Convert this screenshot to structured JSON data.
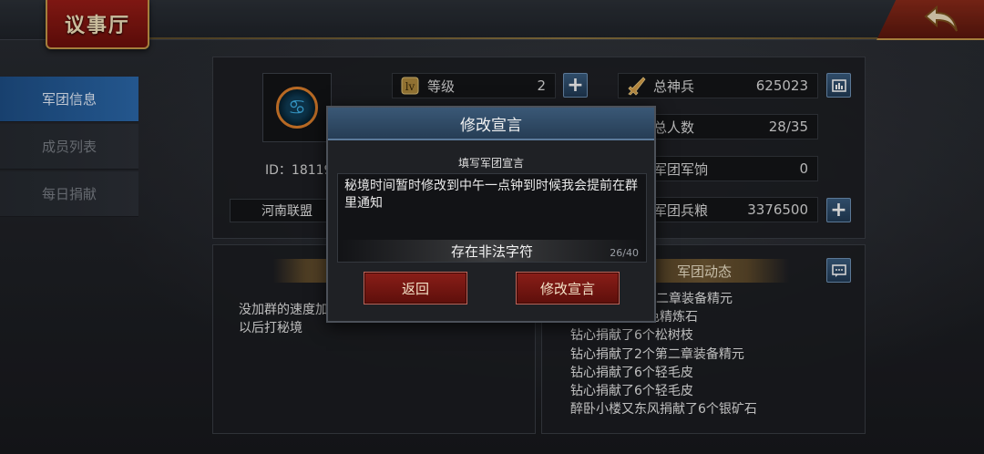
{
  "header": {
    "title": "议事厅"
  },
  "sidebar": {
    "items": [
      {
        "label": "军团信息",
        "active": true
      },
      {
        "label": "成员列表",
        "active": false
      },
      {
        "label": "每日捐献",
        "active": false
      }
    ]
  },
  "legion": {
    "id_text": "ID：18119",
    "name": "河南联盟",
    "level_label": "等级",
    "level_value": "2",
    "total_troops_label": "总神兵",
    "total_troops_value": "625023",
    "members_label": "总人数",
    "members_value": "28/35",
    "pay_label": "军团军饷",
    "pay_value": "0",
    "grain_label": "军团兵粮",
    "grain_value": "3376500"
  },
  "declaration": {
    "text": "没加群的速度加 以后打秘境"
  },
  "news": {
    "title": "军团动态",
    "items": [
      "第二章装备精元",
      "蓝色精炼石",
      "钻心捐献了6个松树枝",
      "钻心捐献了2个第二章装备精元",
      "钻心捐献了6个轻毛皮",
      "钻心捐献了6个轻毛皮",
      "醉卧小楼又东风捐献了6个银矿石"
    ]
  },
  "modal": {
    "title": "修改宣言",
    "subtitle": "填写军团宣言",
    "input_text": "秘境时间暂时修改到中午一点钟到时候我会提前在群里通知",
    "error": "存在非法字符",
    "counter": "26/40",
    "back_label": "返回",
    "submit_label": "修改宣言"
  },
  "colors": {
    "accent_blue": "#2c6aad",
    "button_red": "#8a1e18",
    "gold": "#c99a4a"
  }
}
